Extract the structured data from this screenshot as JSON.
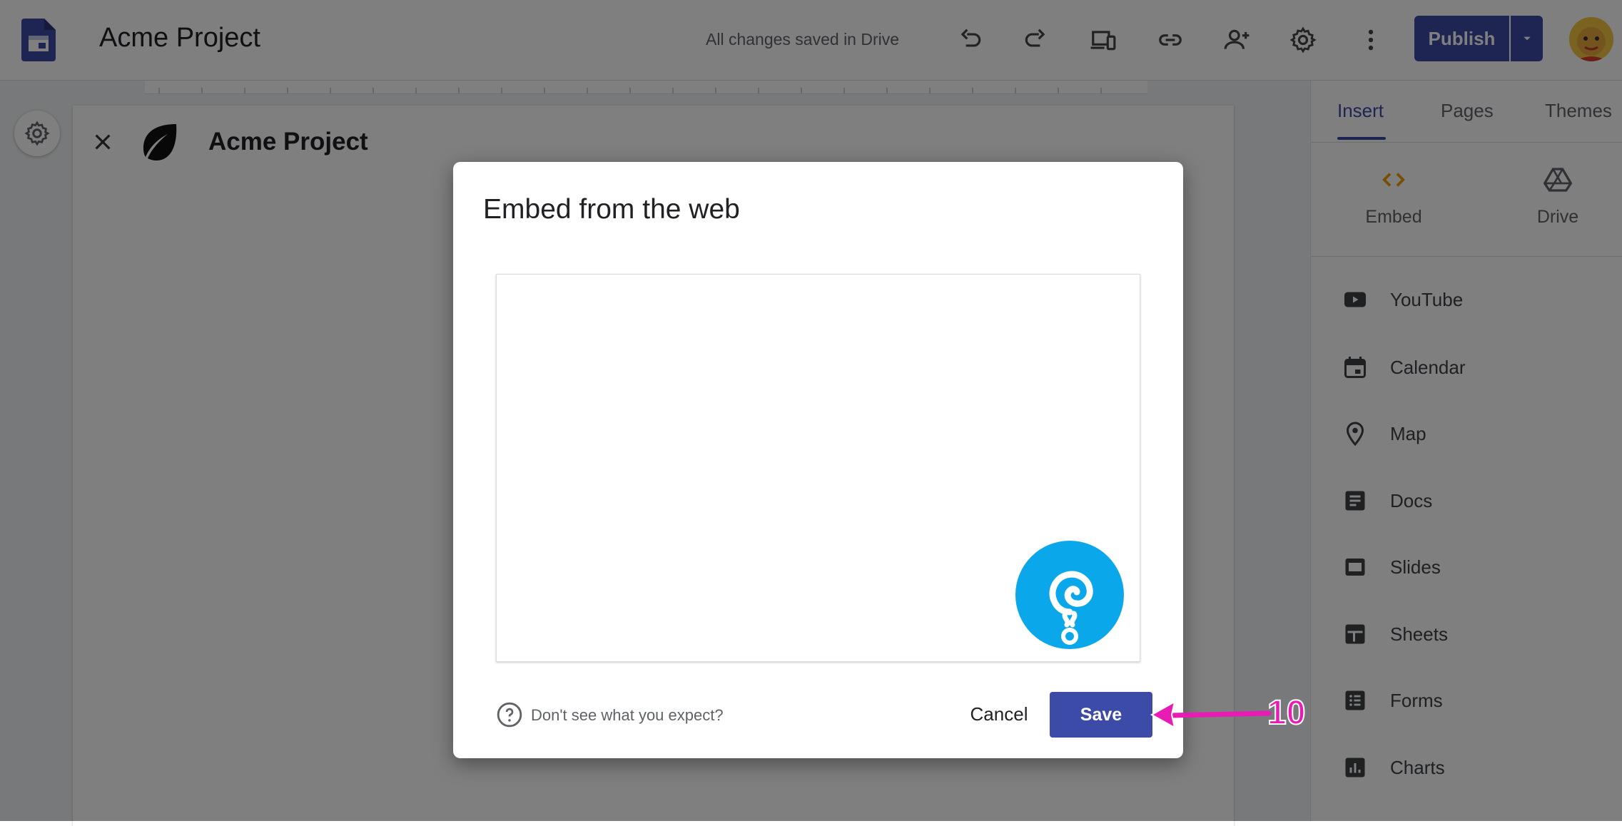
{
  "header": {
    "title": "Acme Project",
    "save_status": "All changes saved in Drive",
    "publish_label": "Publish"
  },
  "site": {
    "title": "Acme Project"
  },
  "panel": {
    "tabs": [
      {
        "label": "Insert",
        "active": true
      },
      {
        "label": "Pages",
        "active": false
      },
      {
        "label": "Themes",
        "active": false
      }
    ],
    "big_items": [
      {
        "label": "Embed",
        "icon": "code-icon"
      },
      {
        "label": "Drive",
        "icon": "drive-icon"
      }
    ],
    "list_items": [
      {
        "label": "YouTube",
        "icon": "youtube-icon"
      },
      {
        "label": "Calendar",
        "icon": "calendar-icon"
      },
      {
        "label": "Map",
        "icon": "map-pin-icon"
      },
      {
        "label": "Docs",
        "icon": "docs-icon"
      },
      {
        "label": "Slides",
        "icon": "slides-icon"
      },
      {
        "label": "Sheets",
        "icon": "sheets-icon"
      },
      {
        "label": "Forms",
        "icon": "forms-icon"
      },
      {
        "label": "Charts",
        "icon": "charts-icon"
      }
    ]
  },
  "dialog": {
    "title": "Embed from the web",
    "help_text": "Don't see what you expect?",
    "cancel_label": "Cancel",
    "save_label": "Save"
  },
  "annotation": {
    "step_number": "10"
  },
  "colors": {
    "accent": "#3c4ba7",
    "annotation": "#e81cb4",
    "badge": "#0aa8ea"
  }
}
